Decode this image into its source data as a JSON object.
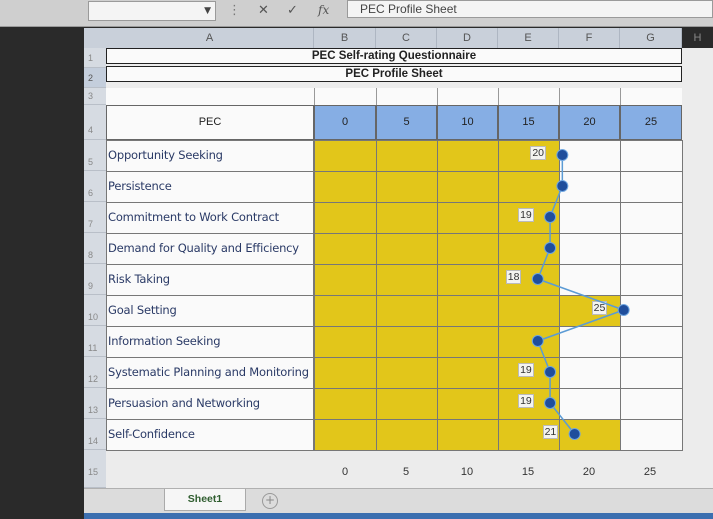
{
  "formula_bar": {
    "name_box": "",
    "cancel_glyph": "✕",
    "confirm_glyph": "✓",
    "fx_label": "fx",
    "content": "PEC Profile Sheet"
  },
  "column_headers": [
    "A",
    "B",
    "C",
    "D",
    "E",
    "F",
    "G"
  ],
  "right_edge_header": "H",
  "row_headers": [
    "1",
    "2",
    "3",
    "4",
    "5",
    "6",
    "7",
    "8",
    "9",
    "10",
    "11",
    "12",
    "13",
    "14",
    "15"
  ],
  "sheet": {
    "title": "PEC Self-rating Questionnaire",
    "subtitle": "PEC Profile Sheet",
    "pec_header": "PEC",
    "scale_headers": [
      "0",
      "5",
      "10",
      "15",
      "20",
      "25"
    ],
    "bottom_ticks": [
      "0",
      "5",
      "10",
      "15",
      "20",
      "25"
    ]
  },
  "chart_data": {
    "type": "line",
    "categories": [
      "Opportunity Seeking",
      "Persistence",
      "Commitment to Work Contract",
      "Demand for Quality and Efficiency",
      "Risk Taking",
      "Goal Setting",
      "Information Seeking",
      "Systematic Planning and Monitoring",
      "Persuasion and Networking",
      "Self-Confidence"
    ],
    "values": [
      20,
      20,
      19,
      19,
      18,
      25,
      18,
      19,
      19,
      21
    ],
    "data_labels": [
      "20",
      "",
      "19",
      "",
      "18",
      "25",
      "",
      "19",
      "19",
      "21"
    ],
    "xlim": [
      0,
      25
    ],
    "line_color": "#5b9bd5",
    "marker_color": "#1f4e9c",
    "bar_color": "#e2c61a",
    "header_color": "#86aee4"
  },
  "tabs": {
    "sheet_name": "Sheet1",
    "add_glyph": "+"
  }
}
